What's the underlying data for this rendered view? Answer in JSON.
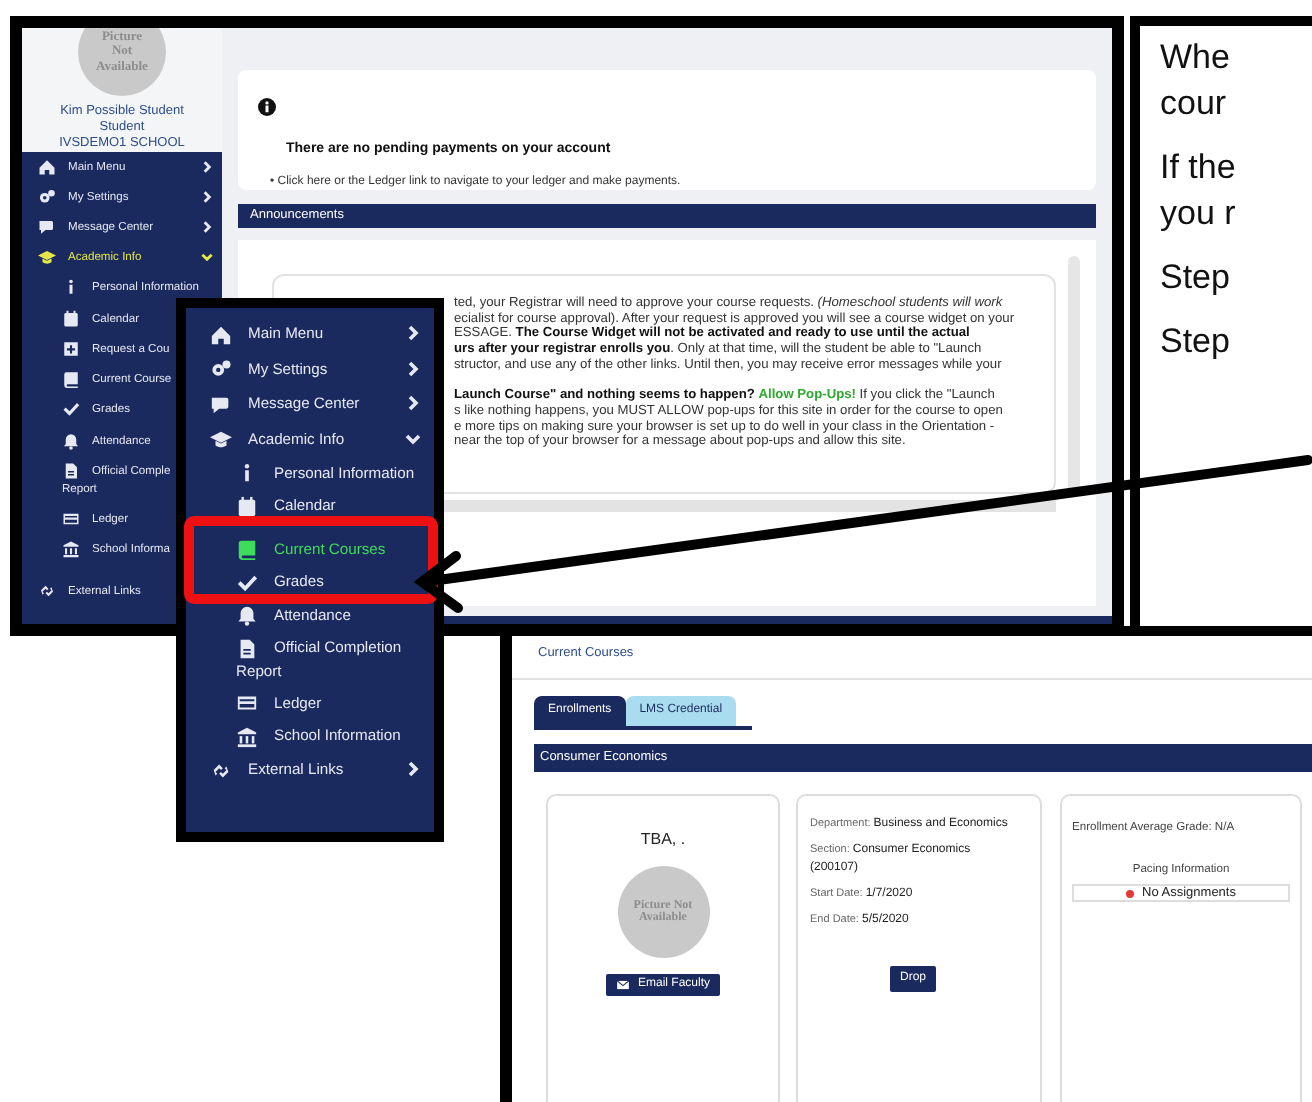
{
  "portal_screenshot": {
    "profile": {
      "photo_text": "Picture Not Available",
      "name": "Kim Possible Student",
      "role": "Student",
      "school": "IVSDEMO1 SCHOOL"
    },
    "menu": [
      {
        "kind": "group",
        "label": "Main Menu",
        "expanded": false,
        "selected": false
      },
      {
        "kind": "group",
        "label": "My Settings",
        "expanded": false,
        "selected": false
      },
      {
        "kind": "group",
        "label": "Message Center",
        "expanded": false,
        "selected": false
      },
      {
        "kind": "group",
        "label": "Academic Info",
        "expanded": true,
        "selected": true
      },
      {
        "kind": "sub",
        "label": "Personal Information",
        "selected": false
      },
      {
        "kind": "sub",
        "label": "Calendar",
        "selected": false
      },
      {
        "kind": "sub",
        "label": "Request a Cou",
        "selected": false
      },
      {
        "kind": "sub",
        "label": "Current Course",
        "selected": false
      },
      {
        "kind": "sub",
        "label": "Grades",
        "selected": false
      },
      {
        "kind": "sub",
        "label": "Attendance",
        "selected": false
      },
      {
        "kind": "sub",
        "label": "Official Comple",
        "continuation": "Report",
        "selected": false
      },
      {
        "kind": "sub",
        "label": "Ledger",
        "selected": false
      },
      {
        "kind": "sub",
        "label": "School Informa",
        "selected": false
      },
      {
        "kind": "item",
        "label": "External Links",
        "selected": false
      }
    ],
    "payment_notice": {
      "title": "There are no pending payments on your account",
      "bullet": "•",
      "text_before": "Click ",
      "link": "here",
      "text_after": " or the Ledger link to navigate to your ledger and make payments."
    },
    "announcements": {
      "title": "Announcements",
      "paragraphs": [
        [
          {
            "text": "ted, your Registrar will need to approve your course requests.  *(Homeschool students will work*"
          },
          {
            "text": "ecialist for course approval). After your request is approved you will see a course widget on your"
          },
          {
            "text": "ESSAGE. **The Course Widget will not be activated and ready to use until the actual**"
          },
          {
            "text": "**urs after your registrar enrolls you**.  Only at that time, will the student be able to \"Launch"
          },
          {
            "text": "structor, and use any of the other links.  Until then, you may receive error messages while your"
          }
        ],
        [
          {
            "text": "**Launch Course\" and nothing seems to happen?** ",
            "highlight": "Allow Pop-Ups!",
            "after": " If you click the \"Launch"
          },
          {
            "text": "s like nothing happens, you MUST ALLOW pop-ups for this site in order for the course to open"
          },
          {
            "text": "e more tips on making sure your browser is set up to do well in your class in the Orientation -"
          },
          {
            "text": "near the top of your browser for a message about pop-ups and allow this site."
          }
        ]
      ]
    }
  },
  "instruction_text": [
    [
      "Whe",
      "cour"
    ],
    [
      "If the",
      "you r"
    ],
    [
      "Step"
    ],
    [
      "Step"
    ]
  ],
  "zoomed_menu": {
    "items": [
      {
        "kind": "group",
        "label": "Main Menu",
        "expanded": false,
        "selected": false
      },
      {
        "kind": "group",
        "label": "My Settings",
        "expanded": false,
        "selected": false
      },
      {
        "kind": "group",
        "label": "Message Center",
        "expanded": false,
        "selected": false
      },
      {
        "kind": "group",
        "label": "Academic Info",
        "expanded": true,
        "selected": false
      },
      {
        "kind": "sub",
        "label": "Personal Information",
        "selected": false
      },
      {
        "kind": "sub",
        "label": "Calendar",
        "selected": false
      },
      {
        "kind": "sub",
        "label": "Current Courses",
        "selected": true
      },
      {
        "kind": "sub",
        "label": "Grades",
        "selected": false
      },
      {
        "kind": "sub",
        "label": "Attendance",
        "selected": false
      },
      {
        "kind": "sub",
        "label": "Official Completion Report",
        "selected": false
      },
      {
        "kind": "sub",
        "label": "Ledger",
        "selected": false
      },
      {
        "kind": "sub",
        "label": "School Information",
        "selected": false
      },
      {
        "kind": "group",
        "label": "External Links",
        "expanded": false,
        "selected": false
      }
    ]
  },
  "courses_screenshot": {
    "title": "Current Courses",
    "tabs": [
      {
        "label": "Enrollments",
        "selected": true
      },
      {
        "label": "LMS Credential",
        "selected": false
      }
    ],
    "course_title": "Consumer Economics",
    "teacher": {
      "name": "TBA, .",
      "photo_text": "Picture Not Available",
      "button": "Email Faculty"
    },
    "details": [
      {
        "label": "Department: ",
        "value": "Business and Economics"
      },
      {
        "label": "Section: ",
        "value": "Consumer Economics (200107)"
      },
      {
        "label": "Start Date: ",
        "value": "1/7/2020"
      },
      {
        "label": "End Date: ",
        "value": "5/5/2020"
      }
    ],
    "drop_button": "Drop",
    "grade": {
      "text": "Enrollment Average Grade: N/A",
      "pacing_title": "Pacing Information",
      "pacing_status": "No Assignments",
      "color": "#e53935"
    }
  }
}
